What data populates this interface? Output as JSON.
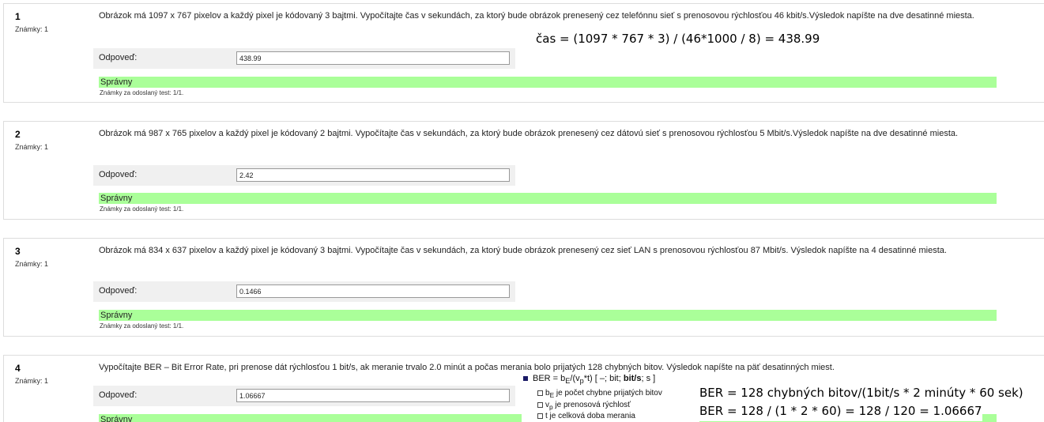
{
  "questions": [
    {
      "number": "1",
      "marks": "Známky: 1",
      "text": "Obrázok má 1097 x 767 pixelov a každý pixel je kódovaný 3 bajtmi. Vypočítajte čas v sekundách, za ktorý bude obrázok prenesený cez telefónnu sieť s prenosovou rýchlosťou 46 kbit/s.Výsledok napíšte na dve desatinné miesta.",
      "answer_label": "Odpoveď:",
      "answer_value": "438.99",
      "status": "Správny",
      "marks_note": "Známky za odoslaný test: 1/1."
    },
    {
      "number": "2",
      "marks": "Známky: 1",
      "text": "Obrázok má 987 x 765 pixelov a každý pixel je kódovaný 2 bajtmi. Vypočítajte čas v sekundách, za ktorý bude obrázok prenesený cez dátovú sieť s prenosovou rýchlosťou 5 Mbit/s.Výsledok napíšte na dve desatinné miesta.",
      "answer_label": "Odpoveď:",
      "answer_value": "2.42",
      "status": "Správny",
      "marks_note": "Známky za odoslaný test: 1/1."
    },
    {
      "number": "3",
      "marks": "Známky: 1",
      "text": "Obrázok má 834 x 637 pixelov a každý pixel je kódovaný 3 bajtmi. Vypočítajte čas v sekundách, za ktorý bude obrázok prenesený cez sieť LAN s prenosovou rýchlosťou 87 Mbit/s. Výsledok napíšte na 4 desatinné miesta.",
      "answer_label": "Odpoveď:",
      "answer_value": "0.1466",
      "status": "Správny",
      "marks_note": "Známky za odoslaný test: 1/1."
    },
    {
      "number": "4",
      "marks": "Známky: 1",
      "text": "Vypočítajte BER – Bit Error Rate, pri prenose dát rýchlosťou 1 bit/s, ak meranie trvalo 2.0 minút a počas merania bolo prijatých 128 chybných bitov. Výsledok napíšte na päť desatinných miest.",
      "answer_label": "Odpoveď:",
      "answer_value": "1.06667",
      "status": "Správny"
    }
  ],
  "annotations": {
    "q1_formula": "čas = (1097 * 767 * 3) / (46*1000 / 8) = 438.99",
    "ber_line1": "BER = 128 chybných bitov/(1bit/s * 2 minúty * 60 sek)",
    "ber_line2": "BER = 128 / (1 * 2 * 60) = 128 / 120 = 1.06667"
  },
  "hint": {
    "title_pre": "BER = b",
    "title_sub1": "E",
    "title_mid": "/(v",
    "title_sub2": "p",
    "title_post": "*t) [ –; bit; ",
    "title_bold": "bit/s",
    "title_end": "; s ]",
    "line1_pre": "b",
    "line1_sub": "E",
    "line1_post": " je počet chybne prijatých bitov",
    "line2_pre": "v",
    "line2_sub": "p",
    "line2_post": " je prenosová rýchlosť",
    "line3": "t je celková doba merania"
  }
}
